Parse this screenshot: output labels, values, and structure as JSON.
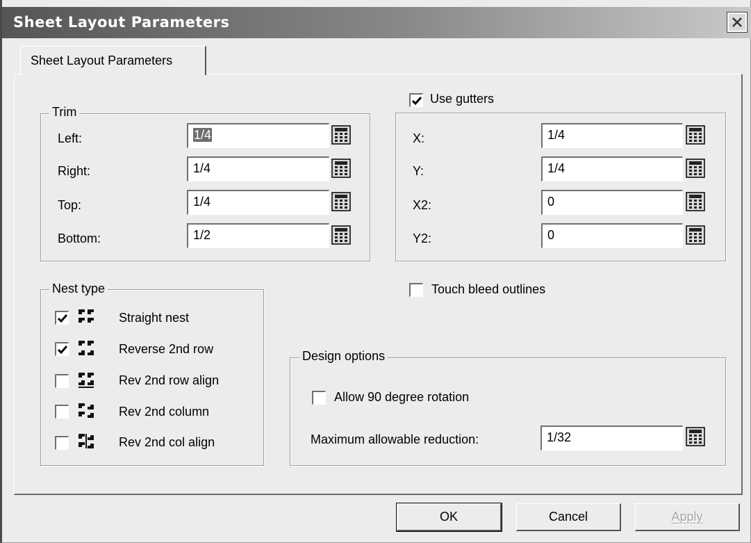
{
  "window": {
    "title": "Sheet Layout Parameters"
  },
  "tab": {
    "label": "Sheet Layout Parameters"
  },
  "trim": {
    "legend": "Trim",
    "fields": [
      {
        "label": "Left:",
        "value": "1/4",
        "selected": true
      },
      {
        "label": "Right:",
        "value": "1/4"
      },
      {
        "label": "Top:",
        "value": "1/4"
      },
      {
        "label": "Bottom:",
        "value": "1/2"
      }
    ]
  },
  "gutters": {
    "checkbox_label": "Use gutters",
    "checked": true,
    "fields": [
      {
        "label": "X:",
        "value": "1/4"
      },
      {
        "label": "Y:",
        "value": "1/4"
      },
      {
        "label": "X2:",
        "value": "0"
      },
      {
        "label": "Y2:",
        "value": "0"
      }
    ]
  },
  "nest_type": {
    "legend": "Nest type",
    "options": [
      {
        "label": "Straight nest",
        "checked": true,
        "icon": "straight-nest-icon"
      },
      {
        "label": "Reverse 2nd row",
        "checked": true,
        "icon": "reverse-2nd-row-icon"
      },
      {
        "label": "Rev 2nd row align",
        "checked": false,
        "icon": "rev-2nd-row-align-icon"
      },
      {
        "label": "Rev 2nd column",
        "checked": false,
        "icon": "rev-2nd-column-icon"
      },
      {
        "label": "Rev 2nd col align",
        "checked": false,
        "icon": "rev-2nd-col-align-icon"
      }
    ]
  },
  "touch_bleed": {
    "label": "Touch bleed outlines",
    "checked": false
  },
  "design_options": {
    "legend": "Design options",
    "rotation_label": "Allow 90 degree rotation",
    "rotation_checked": false,
    "reduction_label": "Maximum allowable reduction:",
    "reduction_value": "1/32"
  },
  "buttons": {
    "ok": "OK",
    "cancel": "Cancel",
    "apply": "Apply"
  }
}
